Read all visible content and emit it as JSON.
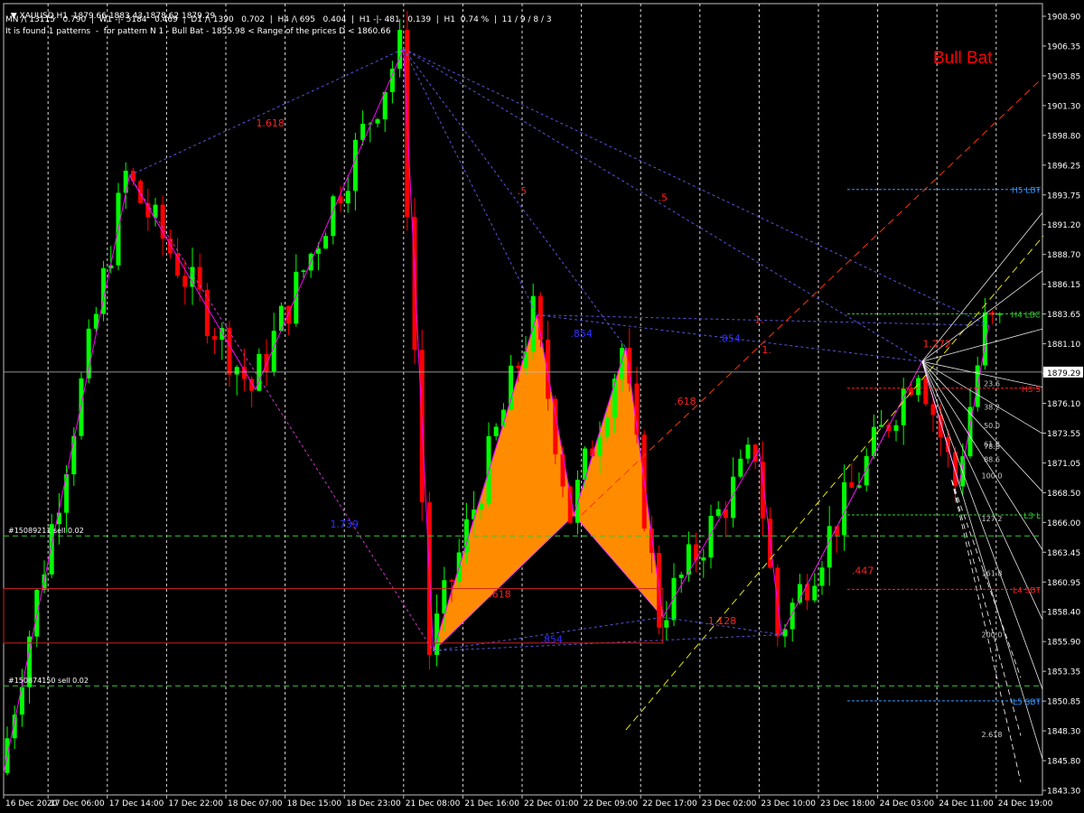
{
  "header": {
    "symbol_line": "XAUUSD,H1  1879.66 1883.43 1878.62 1879.29",
    "stats_line": "MN /\\ 13115   0.790  |  W1 -|- 5184   0.469  |  D1 /\\ 1390   0.702  |  H4 /\\ 695   0.404  |  H1 -|- 481   0.139  |  H1  0.74 %  |  11 / 9 / 8 / 3",
    "pattern_line": "It is found 1 patterns  -  for pattern N 1 - Bull Bat - 1855.98 < Range of the prices D < 1860.66"
  },
  "pattern_title": "Bull Bat",
  "colors": {
    "background": "#000000",
    "bull_candle": "#00ff00",
    "bear_candle": "#ff0000",
    "pattern_fill": "#ff8c00",
    "zigzag": "#ff00ff",
    "price_line": "#c0c0c0",
    "axis_text": "#ffffff"
  },
  "chart_data": {
    "type": "candlestick",
    "symbol": "XAUUSD",
    "timeframe": "H1",
    "ylim": [
      1843.3,
      1909.9
    ],
    "current_price": "1879.29",
    "y_ticks": [
      "1908.90",
      "1906.35",
      "1903.85",
      "1901.30",
      "1898.80",
      "1896.25",
      "1893.75",
      "1891.20",
      "1888.70",
      "1886.15",
      "1883.65",
      "1881.10",
      "1878.60",
      "1876.10",
      "1873.55",
      "1871.05",
      "1868.50",
      "1866.00",
      "1863.45",
      "1860.95",
      "1858.40",
      "1855.90",
      "1853.35",
      "1850.85",
      "1848.30",
      "1845.80",
      "1843.30"
    ],
    "x_ticks": [
      {
        "label": "16 Dec 2020",
        "bar": 0
      },
      {
        "label": "17 Dec 06:00",
        "bar": 6
      },
      {
        "label": "17 Dec 14:00",
        "bar": 14
      },
      {
        "label": "17 Dec 22:00",
        "bar": 22
      },
      {
        "label": "18 Dec 07:00",
        "bar": 30
      },
      {
        "label": "18 Dec 15:00",
        "bar": 38
      },
      {
        "label": "18 Dec 23:00",
        "bar": 46
      },
      {
        "label": "21 Dec 08:00",
        "bar": 54
      },
      {
        "label": "21 Dec 16:00",
        "bar": 62
      },
      {
        "label": "22 Dec 01:00",
        "bar": 70
      },
      {
        "label": "22 Dec 09:00",
        "bar": 78
      },
      {
        "label": "22 Dec 17:00",
        "bar": 86
      },
      {
        "label": "23 Dec 02:00",
        "bar": 94
      },
      {
        "label": "23 Dec 10:00",
        "bar": 102
      },
      {
        "label": "23 Dec 18:00",
        "bar": 110
      },
      {
        "label": "24 Dec 03:00",
        "bar": 118
      },
      {
        "label": "24 Dec 11:00",
        "bar": 126
      },
      {
        "label": "24 Dec 19:00",
        "bar": 134
      }
    ],
    "zigzag": [
      {
        "bar": 0,
        "price": 1844.8
      },
      {
        "bar": 17,
        "price": 1896.2
      },
      {
        "bar": 34,
        "price": 1877.8
      },
      {
        "bar": 54,
        "price": 1907.1
      },
      {
        "bar": 58,
        "price": 1855.3
      },
      {
        "bar": 72,
        "price": 1884.2
      },
      {
        "bar": 77,
        "price": 1867.0
      },
      {
        "bar": 84,
        "price": 1881.4
      },
      {
        "bar": 89,
        "price": 1858.2
      },
      {
        "bar": 102,
        "price": 1872.6
      },
      {
        "bar": 105,
        "price": 1856.7
      },
      {
        "bar": 124,
        "price": 1880.2
      },
      {
        "bar": 129,
        "price": 1869.6
      },
      {
        "bar": 133,
        "price": 1883.3
      }
    ],
    "ratio_labels": [
      {
        "text": "1.618",
        "bar": 36,
        "price": 1900.4,
        "color": "#ff2020"
      },
      {
        "text": "1.739",
        "bar": 46,
        "price": 1865.9,
        "color": "#3030ff"
      },
      {
        "text": ".5",
        "bar": 70,
        "price": 1894.6,
        "color": "#ff2020"
      },
      {
        "text": ".5",
        "bar": 89,
        "price": 1894.0,
        "color": "#ff2020"
      },
      {
        "text": ".854",
        "bar": 78,
        "price": 1882.3,
        "color": "#3030ff"
      },
      {
        "text": ".854",
        "bar": 98,
        "price": 1881.9,
        "color": "#3030ff"
      },
      {
        "text": "1.",
        "bar": 102,
        "price": 1883.5,
        "color": "#ff2020"
      },
      {
        "text": "1.",
        "bar": 103,
        "price": 1880.9,
        "color": "#ff2020"
      },
      {
        "text": ".618",
        "bar": 92,
        "price": 1876.5,
        "color": "#ff2020"
      },
      {
        "text": ".618",
        "bar": 67,
        "price": 1859.9,
        "color": "#ff2020"
      },
      {
        "text": ".854",
        "bar": 74,
        "price": 1856.0,
        "color": "#3030ff"
      },
      {
        "text": "1.128",
        "bar": 97,
        "price": 1857.6,
        "color": "#ff2020"
      },
      {
        "text": ".447",
        "bar": 116,
        "price": 1861.9,
        "color": "#ff2020"
      },
      {
        "text": "1.272",
        "bar": 126,
        "price": 1881.4,
        "color": "#ff2020"
      }
    ],
    "levels": [
      {
        "label": "H5 LBT",
        "price": 1895.0,
        "color": "#3399ff"
      },
      {
        "label": "H4 LBC",
        "price": 1884.3,
        "color": "#33cc33"
      },
      {
        "label": "H3 S",
        "price": 1877.9,
        "color": "#ff2020"
      },
      {
        "label": "L3 L",
        "price": 1867.0,
        "color": "#33cc33"
      },
      {
        "label": "L4 SBT",
        "price": 1860.6,
        "color": "#ff2020"
      },
      {
        "label": "L5 SBT",
        "price": 1851.0,
        "color": "#3399ff"
      }
    ],
    "fib_labels": [
      {
        "text": "23.6",
        "price": 1878.3
      },
      {
        "text": "38.2",
        "price": 1876.3
      },
      {
        "text": "50.0",
        "price": 1874.7
      },
      {
        "text": "61.8",
        "price": 1873.1
      },
      {
        "text": "78.6",
        "price": 1872.9
      },
      {
        "text": "88.6",
        "price": 1871.8
      },
      {
        "text": "100.0",
        "price": 1870.4
      },
      {
        "text": "127.2",
        "price": 1866.7
      },
      {
        "text": "161.8",
        "price": 1862.0
      },
      {
        "text": "200.0",
        "price": 1856.7
      },
      {
        "text": "2.618",
        "price": 1848.1
      }
    ],
    "orders": [
      {
        "label": "#15089211 sell 0.02",
        "price": 1865.2
      },
      {
        "label": "#150874150 sell 0.02",
        "price": 1852.3
      }
    ]
  }
}
